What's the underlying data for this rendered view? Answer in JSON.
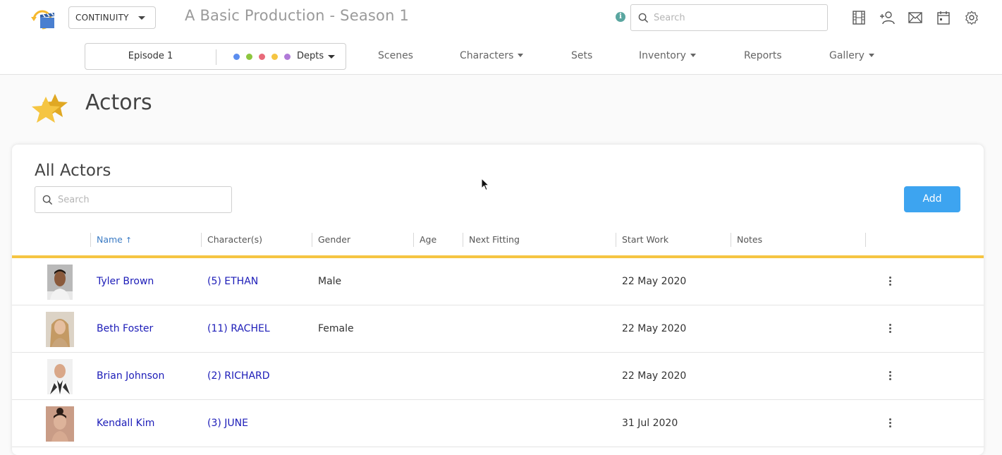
{
  "header": {
    "mode_label": "CONTINUITY",
    "production_title": "A Basic Production - Season 1",
    "search_placeholder": "Search",
    "icons": [
      "film-icon",
      "add-user-icon",
      "mail-icon",
      "calendar-icon",
      "settings-icon"
    ]
  },
  "subnav": {
    "episode_label": "Episode 1",
    "depts_label": "Depts",
    "dept_colors": [
      "#5b8def",
      "#8dc63f",
      "#e86a7a",
      "#f5c542",
      "#b07ad8"
    ],
    "items": [
      {
        "label": "Scenes",
        "dropdown": false
      },
      {
        "label": "Characters",
        "dropdown": true
      },
      {
        "label": "Sets",
        "dropdown": false
      },
      {
        "label": "Inventory",
        "dropdown": true
      },
      {
        "label": "Reports",
        "dropdown": false
      },
      {
        "label": "Gallery",
        "dropdown": true
      }
    ]
  },
  "page": {
    "title": "Actors"
  },
  "card": {
    "title": "All Actors",
    "search_placeholder": "Search",
    "add_label": "Add",
    "columns": [
      "Name",
      "Character(s)",
      "Gender",
      "Age",
      "Next Fitting",
      "Start Work",
      "Notes"
    ],
    "sorted_column": "Name",
    "accent_color": "#f5c542",
    "rows": [
      {
        "name": "Tyler Brown",
        "character": "(5) ETHAN",
        "gender": "Male",
        "age": "",
        "next_fitting": "",
        "start_work": "22 May 2020",
        "notes": ""
      },
      {
        "name": "Beth Foster",
        "character": "(11) RACHEL",
        "gender": "Female",
        "age": "",
        "next_fitting": "",
        "start_work": "22 May 2020",
        "notes": ""
      },
      {
        "name": "Brian Johnson",
        "character": "(2) RICHARD",
        "gender": "",
        "age": "",
        "next_fitting": "",
        "start_work": "22 May 2020",
        "notes": ""
      },
      {
        "name": "Kendall Kim",
        "character": "(3) JUNE",
        "gender": "",
        "age": "",
        "next_fitting": "",
        "start_work": "31 Jul 2020",
        "notes": ""
      }
    ]
  }
}
